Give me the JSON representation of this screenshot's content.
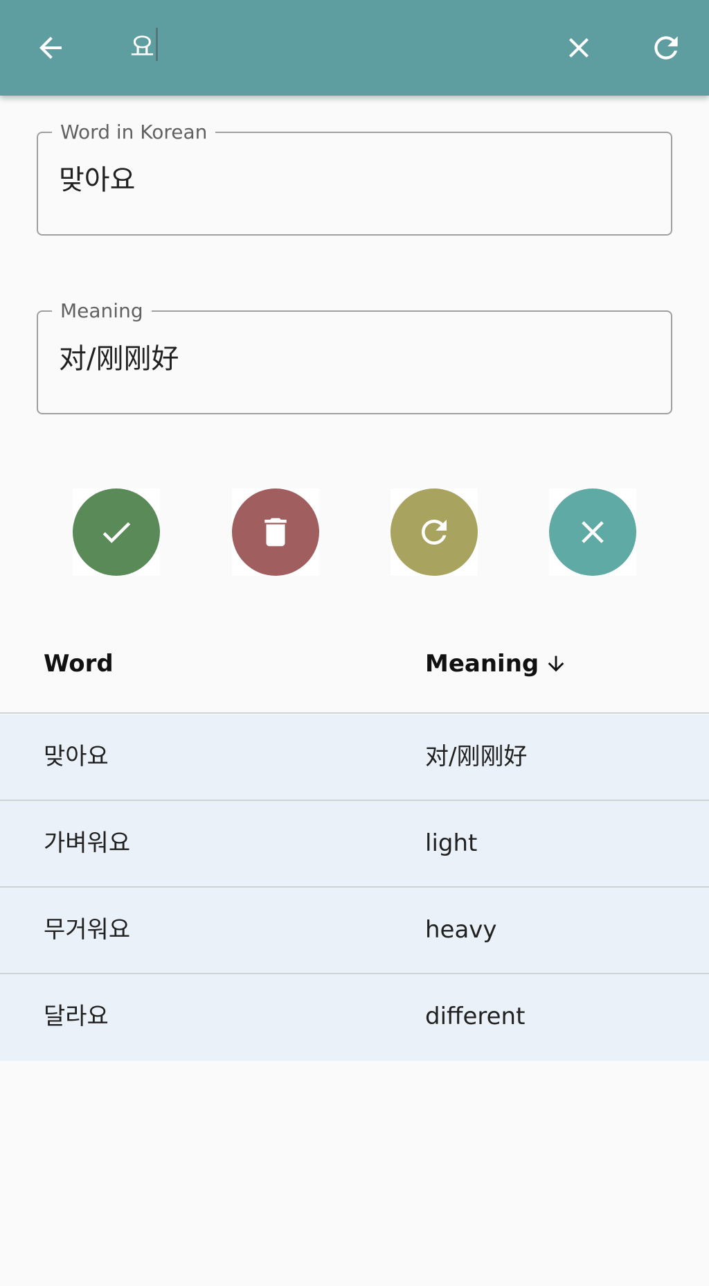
{
  "app_bar": {
    "search_query": "요",
    "back_icon": "arrow-back-icon",
    "clear_icon": "close-icon",
    "refresh_icon": "refresh-icon",
    "color": "#5f9ea0"
  },
  "form": {
    "word": {
      "label": "Word in Korean",
      "value": "맞아요"
    },
    "meaning": {
      "label": "Meaning",
      "value": "对/刚刚好"
    }
  },
  "actions": [
    {
      "name": "save",
      "icon": "check-icon",
      "color": "#5a8a58"
    },
    {
      "name": "delete",
      "icon": "trash-icon",
      "color": "#a05e5e"
    },
    {
      "name": "reset",
      "icon": "refresh-icon",
      "color": "#a8a35e"
    },
    {
      "name": "cancel",
      "icon": "close-icon",
      "color": "#5faaa5"
    }
  ],
  "table": {
    "columns": [
      "Word",
      "Meaning"
    ],
    "sort_column": "Meaning",
    "sort_direction": "descending",
    "rows": [
      {
        "word": "맞아요",
        "meaning": "对/刚刚好"
      },
      {
        "word": "가벼워요",
        "meaning": "light"
      },
      {
        "word": "무거워요",
        "meaning": "heavy"
      },
      {
        "word": "달라요",
        "meaning": "different"
      }
    ],
    "row_color": "#eaf1f8"
  }
}
